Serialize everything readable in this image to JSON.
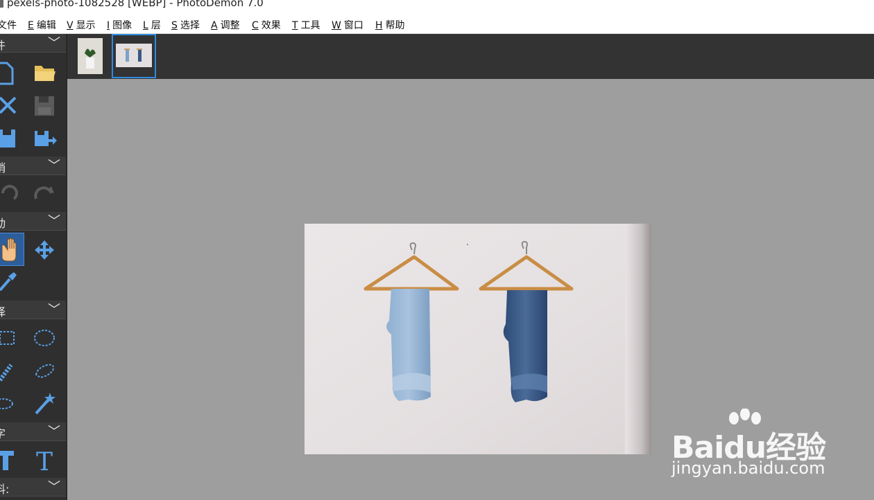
{
  "window": {
    "title": "pexels-photo-1082528 [WEBP]  -  PhotoDemon 7.0"
  },
  "menu": [
    {
      "key": "",
      "label": "文件"
    },
    {
      "key": "E",
      "label": "编辑"
    },
    {
      "key": "V",
      "label": "显示"
    },
    {
      "key": "I",
      "label": "图像"
    },
    {
      "key": "L",
      "label": "层"
    },
    {
      "key": "S",
      "label": "选择"
    },
    {
      "key": "A",
      "label": "调整"
    },
    {
      "key": "C",
      "label": "效果"
    },
    {
      "key": "T",
      "label": "工具"
    },
    {
      "key": "W",
      "label": "窗口"
    },
    {
      "key": "H",
      "label": "帮助"
    }
  ],
  "toolbox": {
    "sections": [
      {
        "label": "件",
        "chevron": "﹀"
      },
      {
        "label": "销",
        "chevron": "﹀"
      },
      {
        "label": "动",
        "chevron": "﹀"
      },
      {
        "label": "择",
        "chevron": "﹀"
      },
      {
        "label": "字",
        "chevron": "﹀"
      },
      {
        "label": "料:",
        "chevron": "﹀"
      }
    ],
    "text_tool_glyph": "T"
  },
  "thumbnails": [
    {
      "name": "plant-photo",
      "selected": false
    },
    {
      "name": "jeans-photo",
      "selected": true
    }
  ],
  "watermark": {
    "brand": "Baidu经验",
    "site": "jingyan.baidu.com"
  },
  "colors": {
    "accent": "#2f8ae0",
    "tool_icon": "#5aa0e6",
    "folder": "#e6c15a",
    "canvas_bg": "#9e9e9e",
    "toolbox_bg": "#2f2f2f"
  }
}
